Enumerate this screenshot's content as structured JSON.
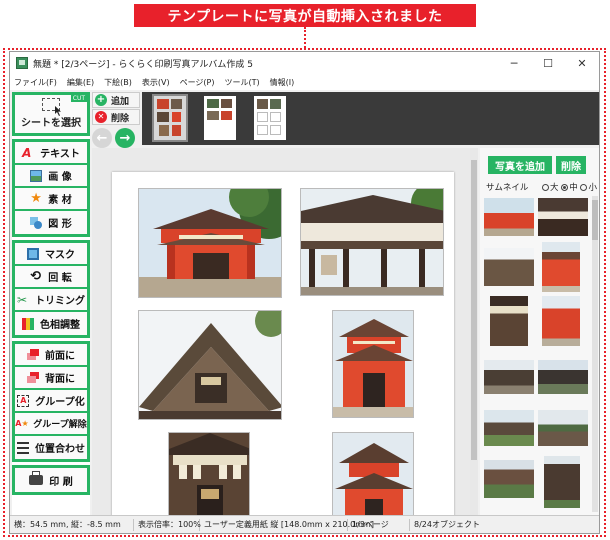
{
  "callout": {
    "text": "テンプレートに写真が自動挿入されました",
    "color": "#e8212b"
  },
  "window": {
    "title": "無題 * [2/3ページ] - らくらく印刷写真アルバム作成 5",
    "controls": {
      "minimize": "─",
      "maximize": "☐",
      "close": "✕"
    }
  },
  "menu": [
    "ファイル(F)",
    "編集(E)",
    "下絵(B)",
    "表示(V)",
    "ページ(P)",
    "ツール(T)",
    "情報(I)"
  ],
  "tools": {
    "cut_badge": "CUT",
    "select_sheet": "シートを選択",
    "group1": [
      {
        "label": "テキスト",
        "icon": "text-a-icon"
      },
      {
        "label": "画 像",
        "icon": "image-icon"
      },
      {
        "label": "素 材",
        "icon": "star-icon"
      },
      {
        "label": "図 形",
        "icon": "shape-icon"
      }
    ],
    "group2": [
      {
        "label": "マスク",
        "icon": "mask-icon"
      },
      {
        "label": "回 転",
        "icon": "rotate-icon"
      },
      {
        "label": "トリミング",
        "icon": "scissors-icon"
      },
      {
        "label": "色相調整",
        "icon": "color-adjust-icon"
      }
    ],
    "group3": [
      {
        "label": "前面に",
        "icon": "bring-front-icon"
      },
      {
        "label": "背面に",
        "icon": "send-back-icon"
      },
      {
        "label": "グループ化",
        "icon": "group-icon"
      },
      {
        "label": "グループ解除",
        "icon": "ungroup-icon"
      },
      {
        "label": "位置合わせ",
        "icon": "align-icon"
      }
    ],
    "print": {
      "label": "印 刷",
      "icon": "printer-icon"
    }
  },
  "pagenav": {
    "add": "追加",
    "delete": "削除"
  },
  "right_panel": {
    "add_photo": "写真を追加",
    "delete": "削除",
    "thumbnail_label": "サムネイル",
    "sizes": [
      "大",
      "中",
      "小"
    ],
    "selected_size": "中"
  },
  "status": {
    "position": "横：54.5 mm, 縦：-8.5 mm",
    "zoom": "表示倍率：100%",
    "paper": "ユーザー定義用紙 縦 [148.0mm x 210.0mm]",
    "page": "1/3ページ",
    "objects": "8/24オブジェクト"
  },
  "colors": {
    "accent_green": "#27b463",
    "accent_red": "#e8212b",
    "shrine_vermilion": "#d9432a"
  }
}
